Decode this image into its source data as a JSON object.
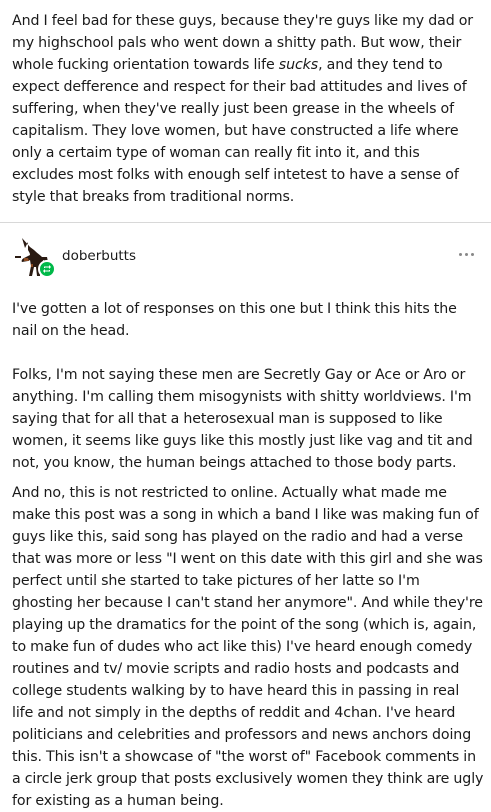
{
  "original_post": {
    "text_before": "And I feel bad for these guys, because they're guys like my dad or my highschool pals who went down a shitty path. But wow, their whole fucking orientation towards life ",
    "emphasis": "sucks",
    "text_after": ", and they tend to expect defference and respect for their bad attitudes and lives of suffering, when they've really just been grease in the wheels of capitalism. They love women, but have constructed a life where only a certaim type of woman can really fit into it, and this excludes most folks with enough self intetest to have a sense of style that breaks from traditional norms."
  },
  "reblog": {
    "username": "doberbutts",
    "avatar_icon": "doberman-dog-icon",
    "badge_icon": "reblog-icon",
    "badge_color": "#00b849",
    "menu_icon": "more-options-icon",
    "paragraphs": [
      "I've gotten a lot of responses on this one but I think this hits the nail on the head.",
      "Folks, I'm not saying these men are Secretly Gay or Ace or Aro or anything. I'm calling them misogynists with shitty worldviews. I'm saying that for all that a heterosexual man is supposed to like women, it seems like guys like this mostly just like vag and tit and not, you know, the human beings attached to those body parts.",
      "And no, this is not restricted to online. Actually what made me make this post was a song in which a band I like was making fun of guys like this, said song has played on the radio and had a verse that was more or less \"I went on this date with this girl and she was perfect until she started to take pictures of her latte so I'm ghosting her because I can't stand her anymore\". And while they're playing up the dramatics for the point of the song (which is, again, to make fun of dudes who act like this) I've heard enough comedy routines and tv/ movie scripts and radio hosts and podcasts and college students walking by to have heard this in passing in real life and not simply in the depths of reddit and 4chan. I've heard politicians and celebrities and professors and news anchors doing this. This isn't a showcase of \"the worst of\" Facebook comments in a circle jerk group that posts exclusively women they think are ugly for existing as a human being."
    ]
  }
}
